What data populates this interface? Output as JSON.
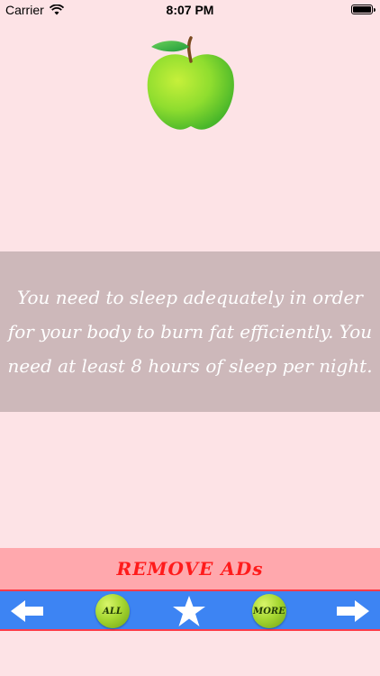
{
  "status_bar": {
    "carrier": "Carrier",
    "time": "8:07 PM",
    "wifi_icon": "wifi-icon",
    "battery_icon": "battery-icon",
    "battery_level": 1.0
  },
  "header": {
    "logo_icon": "apple-icon"
  },
  "content": {
    "quote": "You need to sleep adequately in order for your body to burn fat efficiently.  You need at least 8 hours of sleep per night."
  },
  "ad_banner": {
    "label": "REMOVE ADs"
  },
  "toolbar": {
    "prev_icon": "arrow-left-icon",
    "all_label": "ALL",
    "favorite_icon": "star-icon",
    "more_label": "MORE",
    "next_icon": "arrow-right-icon"
  },
  "colors": {
    "background": "#fde3e6",
    "quote_panel": "#cdb8ba",
    "ad_banner": "#ffa8ad",
    "ad_text": "#ff1b1b",
    "toolbar": "#3d84f3",
    "toolbar_border": "#ff3b47",
    "button_green": "#a7d832"
  }
}
